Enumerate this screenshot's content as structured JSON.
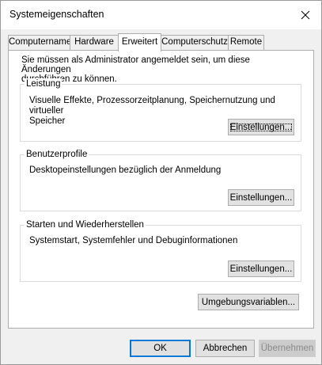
{
  "window": {
    "title": "Systemeigenschaften",
    "close_icon": "close-icon"
  },
  "tabs": [
    {
      "label": "Computername",
      "active": false
    },
    {
      "label": "Hardware",
      "active": false
    },
    {
      "label": "Erweitert",
      "active": true
    },
    {
      "label": "Computerschutz",
      "active": false
    },
    {
      "label": "Remote",
      "active": false
    }
  ],
  "advanced": {
    "info_text": "Sie müssen als Administrator angemeldet sein, um diese Änderungen\ndurchführen zu können.",
    "performance": {
      "label": "Leistung",
      "description": "Visuelle Effekte, Prozessorzeitplanung, Speichernutzung und virtueller\nSpeicher",
      "settings_button": "Einstellungen..."
    },
    "user_profiles": {
      "label": "Benutzerprofile",
      "description": "Desktopeinstellungen bezüglich der Anmeldung",
      "settings_button": "Einstellungen..."
    },
    "startup_recovery": {
      "label": "Starten und Wiederherstellen",
      "description": "Systemstart, Systemfehler und Debuginformationen",
      "settings_button": "Einstellungen..."
    },
    "env_vars_button": "Umgebungsvariablen..."
  },
  "footer": {
    "ok": "OK",
    "cancel": "Abbrechen",
    "apply": "Übernehmen"
  },
  "colors": {
    "dialog_bg": "#f0f0f0",
    "panel_bg": "#ffffff",
    "default_button_border": "#0078d7",
    "disabled_text": "#8a8a8a"
  }
}
